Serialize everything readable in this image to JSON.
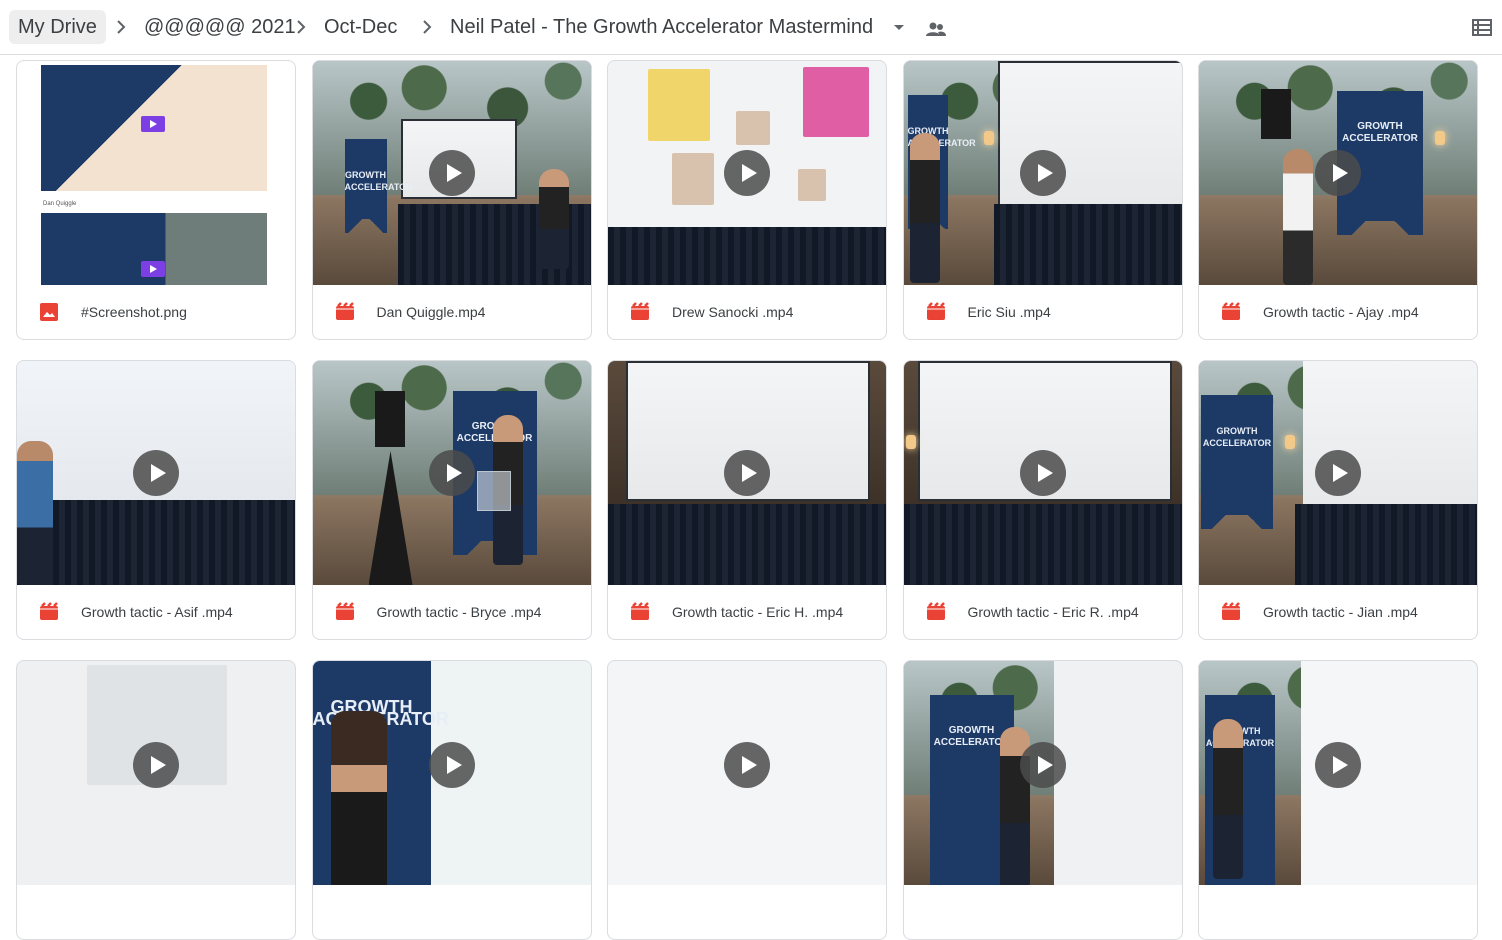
{
  "breadcrumb": {
    "root": "My Drive",
    "items": [
      "@@@@@ 2021",
      "Oct-Dec",
      "Neil Patel - The Growth Accelerator Mastermind"
    ]
  },
  "icons": {
    "separator": "chevron-right-icon",
    "folder_menu": "caret-down-icon",
    "shared": "people-icon",
    "view_toggle": "list-view-icon",
    "image_file": "image-file-icon",
    "video_file": "video-file-icon",
    "play": "play-icon"
  },
  "colors": {
    "file_icon_red": "#ea4335",
    "text": "#3c4043",
    "border": "#dadce0",
    "root_crumb_bg": "#eeeeee"
  },
  "files": [
    {
      "name": "#Screenshot.png",
      "type": "image"
    },
    {
      "name": "Dan Quiggle.mp4",
      "type": "video"
    },
    {
      "name": "Drew Sanocki .mp4",
      "type": "video"
    },
    {
      "name": "Eric Siu .mp4",
      "type": "video"
    },
    {
      "name": "Growth tactic - Ajay .mp4",
      "type": "video"
    },
    {
      "name": "Growth tactic - Asif .mp4",
      "type": "video"
    },
    {
      "name": "Growth tactic - Bryce .mp4",
      "type": "video"
    },
    {
      "name": "Growth tactic - Eric H. .mp4",
      "type": "video"
    },
    {
      "name": "Growth tactic - Eric R. .mp4",
      "type": "video"
    },
    {
      "name": "Growth tactic - Jian .mp4",
      "type": "video"
    },
    {
      "name": "",
      "type": "video"
    },
    {
      "name": "",
      "type": "video"
    },
    {
      "name": "",
      "type": "video"
    },
    {
      "name": "",
      "type": "video"
    },
    {
      "name": "",
      "type": "video"
    }
  ],
  "thumb_text": {
    "banner": "GROWTH ACCELERATOR",
    "screenshot_caption": "Dan Quiggle"
  }
}
